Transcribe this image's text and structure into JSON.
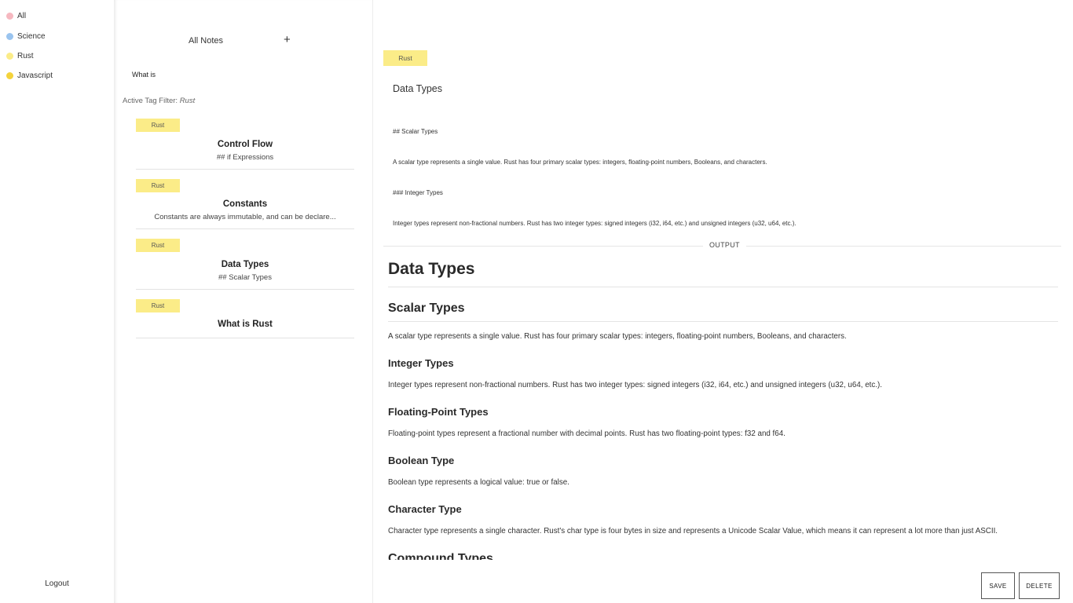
{
  "tags": [
    {
      "label": "All",
      "color": "#f6b8c0"
    },
    {
      "label": "Science",
      "color": "#9ac4ef"
    },
    {
      "label": "Rust",
      "color": "#fbec88"
    },
    {
      "label": "Javascript",
      "color": "#f4d33c"
    }
  ],
  "sidebar": {
    "logout_label": "Logout"
  },
  "notes_list": {
    "header": "All Notes",
    "add_icon": "+",
    "search_value": "What is",
    "filter_prefix": "Active Tag Filter:",
    "filter_value": "Rust",
    "notes": [
      {
        "tag": "Rust",
        "title": "Control Flow",
        "preview": "## if Expressions"
      },
      {
        "tag": "Rust",
        "title": "Constants",
        "preview": "Constants are always immutable, and can be declare..."
      },
      {
        "tag": "Rust",
        "title": "Data Types",
        "preview": "## Scalar Types"
      },
      {
        "tag": "Rust",
        "title": "What is Rust",
        "preview": ""
      }
    ]
  },
  "editor": {
    "tag": "Rust",
    "title": "Data Types",
    "lines": [
      "## Scalar Types",
      "A scalar type represents a single value. Rust has four primary scalar types: integers, floating-point numbers, Booleans, and characters.",
      "### Integer Types",
      "Integer types represent non-fractional numbers. Rust has two integer types: signed integers (i32, i64, etc.) and unsigned integers (u32, u64, etc.)."
    ],
    "output_label": "OUTPUT",
    "save_label": "SAVE",
    "delete_label": "DELETE"
  },
  "output": {
    "h1": "Data Types",
    "h2": "Scalar Types",
    "p1": "A scalar type represents a single value. Rust has four primary scalar types: integers, floating-point numbers, Booleans, and characters.",
    "h3_1": "Integer Types",
    "p2": "Integer types represent non-fractional numbers. Rust has two integer types: signed integers (i32, i64, etc.) and unsigned integers (u32, u64, etc.).",
    "h3_2": "Floating-Point Types",
    "p3": "Floating-point types represent a fractional number with decimal points. Rust has two floating-point types: f32 and f64.",
    "h3_3": "Boolean Type",
    "p4": "Boolean type represents a logical value: true or false.",
    "h3_4": "Character Type",
    "p5": "Character type represents a single character. Rust's char type is four bytes in size and represents a Unicode Scalar Value, which means it can represent a lot more than just ASCII.",
    "h2_2": "Compound Types"
  }
}
